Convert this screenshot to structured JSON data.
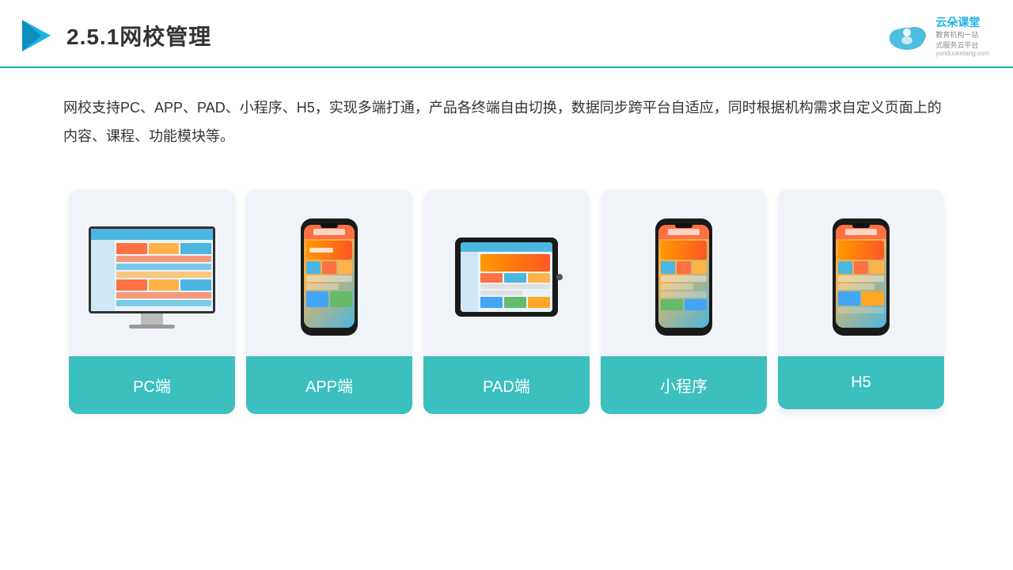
{
  "header": {
    "title": "2.5.1网校管理",
    "logo_brand": "云朵课堂",
    "logo_sub1": "教育机构一站",
    "logo_sub2": "式服务云平台",
    "logo_domain": "yunduoketang.com"
  },
  "description": {
    "text": "网校支持PC、APP、PAD、小程序、H5，实现多端打通，产品各终端自由切换，数据同步跨平台自适应，同时根据机构需求自定义页面上的内容、课程、功能模块等。"
  },
  "cards": [
    {
      "id": "pc",
      "label": "PC端"
    },
    {
      "id": "app",
      "label": "APP端"
    },
    {
      "id": "pad",
      "label": "PAD端"
    },
    {
      "id": "miniprogram",
      "label": "小程序"
    },
    {
      "id": "h5",
      "label": "H5"
    }
  ]
}
